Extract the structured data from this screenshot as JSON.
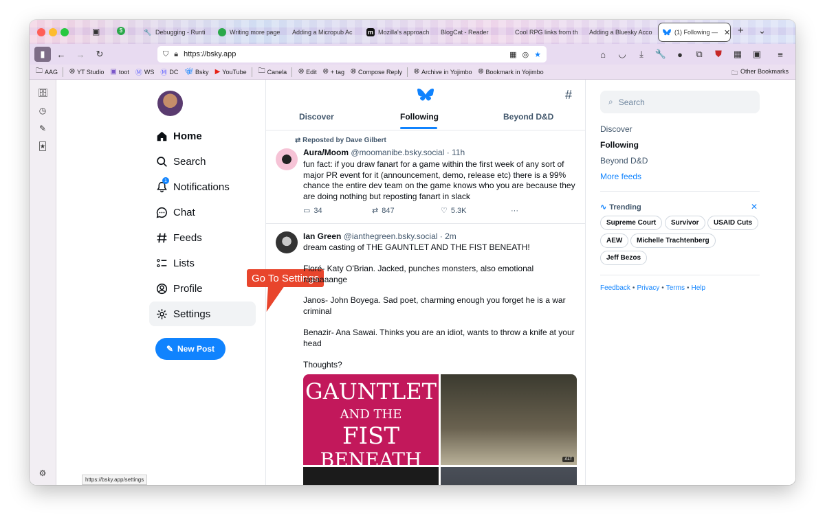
{
  "browser": {
    "tabs": [
      {
        "label": "Debugging - Runti",
        "icon": "wrench-icon"
      },
      {
        "label": "Writing more page",
        "icon": "green-circle-icon"
      },
      {
        "label": "Adding a Micropub Ac",
        "icon": ""
      },
      {
        "label": "Mozilla's approach",
        "icon": "m-icon"
      },
      {
        "label": "BlogCat - Reader",
        "icon": ""
      },
      {
        "label": "Cool RPG links from th",
        "icon": ""
      },
      {
        "label": "Adding a Bluesky Acco",
        "icon": ""
      }
    ],
    "active_tab": {
      "label": "(1) Following —",
      "close": "✕"
    },
    "new_tab": "+",
    "tab_overflow": "⌄",
    "url": "https://bsky.app",
    "bookmarks": [
      {
        "label": "AAG",
        "icon": "folder-icon"
      },
      {
        "label": "YT Studio",
        "icon": "globe-icon"
      },
      {
        "label": "toot",
        "icon": "toot-icon"
      },
      {
        "label": "WS",
        "icon": "mastodon-icon"
      },
      {
        "label": "DC",
        "icon": "mastodon-icon"
      },
      {
        "label": "Bsky",
        "icon": "bluesky-icon"
      },
      {
        "label": "YouTube",
        "icon": "youtube-icon"
      },
      {
        "label": "Canela",
        "icon": "folder-icon"
      },
      {
        "label": "Edit",
        "icon": "globe-icon"
      },
      {
        "label": "+ tag",
        "icon": "globe-icon"
      },
      {
        "label": "Compose Reply",
        "icon": "globe-icon"
      },
      {
        "label": "Archive in Yojimbo",
        "icon": "globe-icon"
      },
      {
        "label": "Bookmark in Yojimbo",
        "icon": "globe-icon"
      }
    ],
    "other_bookmarks": "Other Bookmarks",
    "status_url": "https://bsky.app/settings"
  },
  "nav": {
    "home": "Home",
    "search": "Search",
    "notifications": "Notifications",
    "notifications_badge": "1",
    "chat": "Chat",
    "feeds": "Feeds",
    "lists": "Lists",
    "profile": "Profile",
    "settings": "Settings",
    "new_post": "New Post"
  },
  "callout": "Go To Settings",
  "feed": {
    "tabs": [
      "Discover",
      "Following",
      "Beyond D&D"
    ],
    "active_tab": "Following",
    "posts": [
      {
        "reposted_by": "Reposted by Dave Gilbert",
        "name": "Aura/Moom",
        "handle": "@moomanibe.bsky.social · 11h",
        "text": "fun fact: if you draw fanart for a game within the first week of any sort of major PR event for it (announcement, demo, release etc) there is a 99% chance the entire dev team on the game knows who you are because they are doing nothing but reposting fanart in slack",
        "replies": "34",
        "reposts": "847",
        "likes": "5.3K",
        "more": "···"
      },
      {
        "name": "Ian Green",
        "handle": "@ianthegreen.bsky.social · 2m",
        "paragraphs": [
          "dream casting of THE GAUNTLET AND THE FIST BENEATH!",
          "Floré- Katy O'Brian. Jacked, punches monsters, also emotional raaaaaange",
          "Janos- John Boyega. Sad poet, charming enough you forget he is a war criminal",
          "Benazir- Ana Sawai. Thinks you are an idiot, wants to throw a knife at your head",
          "Thoughts?"
        ],
        "cover_text": [
          "GAUNTLET",
          "AND THE",
          "FIST",
          "BENEATH"
        ],
        "alt_badge": "ALT"
      }
    ]
  },
  "right": {
    "search_placeholder": "Search",
    "feeds": [
      "Discover",
      "Following",
      "Beyond D&D"
    ],
    "more_feeds": "More feeds",
    "trending_title": "Trending",
    "trending": [
      "Supreme Court",
      "Survivor",
      "USAID Cuts",
      "AEW",
      "Michelle Trachtenberg",
      "Jeff Bezos"
    ],
    "footer": [
      "Feedback",
      "Privacy",
      "Terms",
      "Help"
    ]
  },
  "colors": {
    "accent": "#1083fe",
    "callout": "#e8452c"
  }
}
